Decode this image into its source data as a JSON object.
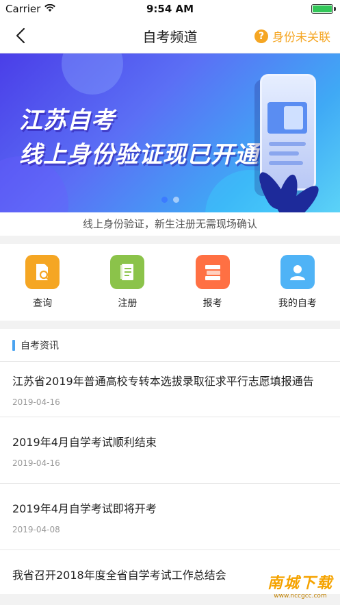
{
  "status_bar": {
    "carrier": "Carrier",
    "time": "9:54 AM"
  },
  "navbar": {
    "title": "自考频道",
    "right_label": "身份未关联",
    "right_icon": "question-icon"
  },
  "banner": {
    "line1": "江苏自考",
    "line2": "线上身份验证现已开通",
    "slide_count": 2,
    "active_slide": 1
  },
  "caption": "线上身份验证，新生注册无需现场确认",
  "quick_actions": [
    {
      "label": "查询",
      "icon": "search-document-icon",
      "color": "#f5a623"
    },
    {
      "label": "注册",
      "icon": "register-book-icon",
      "color": "#8bc34a"
    },
    {
      "label": "报考",
      "icon": "exam-books-icon",
      "color": "#ff7043"
    },
    {
      "label": "我的自考",
      "icon": "user-profile-icon",
      "color": "#4fb3f6"
    }
  ],
  "news": {
    "section_title": "自考资讯",
    "items": [
      {
        "title": "江苏省2019年普通高校专转本选拔录取征求平行志愿填报通告",
        "date": "2019-04-16"
      },
      {
        "title": "2019年4月自学考试顺利结束",
        "date": "2019-04-16"
      },
      {
        "title": "2019年4月自学考试即将开考",
        "date": "2019-04-08"
      },
      {
        "title": "我省召开2018年度全省自学考试工作总结会",
        "date": ""
      }
    ]
  },
  "watermark": {
    "line1": "南城下载",
    "line2": "www.nccgcc.com"
  }
}
